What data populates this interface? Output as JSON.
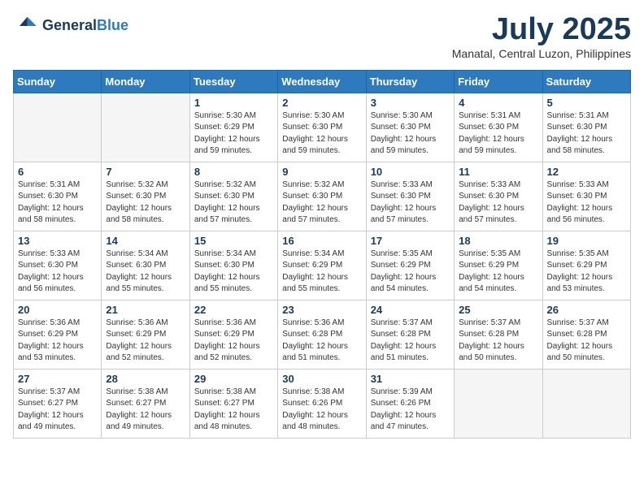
{
  "header": {
    "logo_line1": "General",
    "logo_line2": "Blue",
    "month": "July 2025",
    "location": "Manatal, Central Luzon, Philippines"
  },
  "days_of_week": [
    "Sunday",
    "Monday",
    "Tuesday",
    "Wednesday",
    "Thursday",
    "Friday",
    "Saturday"
  ],
  "weeks": [
    [
      {
        "day": "",
        "empty": true
      },
      {
        "day": "",
        "empty": true
      },
      {
        "day": "1",
        "sunrise": "Sunrise: 5:30 AM",
        "sunset": "Sunset: 6:29 PM",
        "daylight": "Daylight: 12 hours and 59 minutes."
      },
      {
        "day": "2",
        "sunrise": "Sunrise: 5:30 AM",
        "sunset": "Sunset: 6:30 PM",
        "daylight": "Daylight: 12 hours and 59 minutes."
      },
      {
        "day": "3",
        "sunrise": "Sunrise: 5:30 AM",
        "sunset": "Sunset: 6:30 PM",
        "daylight": "Daylight: 12 hours and 59 minutes."
      },
      {
        "day": "4",
        "sunrise": "Sunrise: 5:31 AM",
        "sunset": "Sunset: 6:30 PM",
        "daylight": "Daylight: 12 hours and 59 minutes."
      },
      {
        "day": "5",
        "sunrise": "Sunrise: 5:31 AM",
        "sunset": "Sunset: 6:30 PM",
        "daylight": "Daylight: 12 hours and 58 minutes."
      }
    ],
    [
      {
        "day": "6",
        "sunrise": "Sunrise: 5:31 AM",
        "sunset": "Sunset: 6:30 PM",
        "daylight": "Daylight: 12 hours and 58 minutes."
      },
      {
        "day": "7",
        "sunrise": "Sunrise: 5:32 AM",
        "sunset": "Sunset: 6:30 PM",
        "daylight": "Daylight: 12 hours and 58 minutes."
      },
      {
        "day": "8",
        "sunrise": "Sunrise: 5:32 AM",
        "sunset": "Sunset: 6:30 PM",
        "daylight": "Daylight: 12 hours and 57 minutes."
      },
      {
        "day": "9",
        "sunrise": "Sunrise: 5:32 AM",
        "sunset": "Sunset: 6:30 PM",
        "daylight": "Daylight: 12 hours and 57 minutes."
      },
      {
        "day": "10",
        "sunrise": "Sunrise: 5:33 AM",
        "sunset": "Sunset: 6:30 PM",
        "daylight": "Daylight: 12 hours and 57 minutes."
      },
      {
        "day": "11",
        "sunrise": "Sunrise: 5:33 AM",
        "sunset": "Sunset: 6:30 PM",
        "daylight": "Daylight: 12 hours and 57 minutes."
      },
      {
        "day": "12",
        "sunrise": "Sunrise: 5:33 AM",
        "sunset": "Sunset: 6:30 PM",
        "daylight": "Daylight: 12 hours and 56 minutes."
      }
    ],
    [
      {
        "day": "13",
        "sunrise": "Sunrise: 5:33 AM",
        "sunset": "Sunset: 6:30 PM",
        "daylight": "Daylight: 12 hours and 56 minutes."
      },
      {
        "day": "14",
        "sunrise": "Sunrise: 5:34 AM",
        "sunset": "Sunset: 6:30 PM",
        "daylight": "Daylight: 12 hours and 55 minutes."
      },
      {
        "day": "15",
        "sunrise": "Sunrise: 5:34 AM",
        "sunset": "Sunset: 6:30 PM",
        "daylight": "Daylight: 12 hours and 55 minutes."
      },
      {
        "day": "16",
        "sunrise": "Sunrise: 5:34 AM",
        "sunset": "Sunset: 6:29 PM",
        "daylight": "Daylight: 12 hours and 55 minutes."
      },
      {
        "day": "17",
        "sunrise": "Sunrise: 5:35 AM",
        "sunset": "Sunset: 6:29 PM",
        "daylight": "Daylight: 12 hours and 54 minutes."
      },
      {
        "day": "18",
        "sunrise": "Sunrise: 5:35 AM",
        "sunset": "Sunset: 6:29 PM",
        "daylight": "Daylight: 12 hours and 54 minutes."
      },
      {
        "day": "19",
        "sunrise": "Sunrise: 5:35 AM",
        "sunset": "Sunset: 6:29 PM",
        "daylight": "Daylight: 12 hours and 53 minutes."
      }
    ],
    [
      {
        "day": "20",
        "sunrise": "Sunrise: 5:36 AM",
        "sunset": "Sunset: 6:29 PM",
        "daylight": "Daylight: 12 hours and 53 minutes."
      },
      {
        "day": "21",
        "sunrise": "Sunrise: 5:36 AM",
        "sunset": "Sunset: 6:29 PM",
        "daylight": "Daylight: 12 hours and 52 minutes."
      },
      {
        "day": "22",
        "sunrise": "Sunrise: 5:36 AM",
        "sunset": "Sunset: 6:29 PM",
        "daylight": "Daylight: 12 hours and 52 minutes."
      },
      {
        "day": "23",
        "sunrise": "Sunrise: 5:36 AM",
        "sunset": "Sunset: 6:28 PM",
        "daylight": "Daylight: 12 hours and 51 minutes."
      },
      {
        "day": "24",
        "sunrise": "Sunrise: 5:37 AM",
        "sunset": "Sunset: 6:28 PM",
        "daylight": "Daylight: 12 hours and 51 minutes."
      },
      {
        "day": "25",
        "sunrise": "Sunrise: 5:37 AM",
        "sunset": "Sunset: 6:28 PM",
        "daylight": "Daylight: 12 hours and 50 minutes."
      },
      {
        "day": "26",
        "sunrise": "Sunrise: 5:37 AM",
        "sunset": "Sunset: 6:28 PM",
        "daylight": "Daylight: 12 hours and 50 minutes."
      }
    ],
    [
      {
        "day": "27",
        "sunrise": "Sunrise: 5:37 AM",
        "sunset": "Sunset: 6:27 PM",
        "daylight": "Daylight: 12 hours and 49 minutes."
      },
      {
        "day": "28",
        "sunrise": "Sunrise: 5:38 AM",
        "sunset": "Sunset: 6:27 PM",
        "daylight": "Daylight: 12 hours and 49 minutes."
      },
      {
        "day": "29",
        "sunrise": "Sunrise: 5:38 AM",
        "sunset": "Sunset: 6:27 PM",
        "daylight": "Daylight: 12 hours and 48 minutes."
      },
      {
        "day": "30",
        "sunrise": "Sunrise: 5:38 AM",
        "sunset": "Sunset: 6:26 PM",
        "daylight": "Daylight: 12 hours and 48 minutes."
      },
      {
        "day": "31",
        "sunrise": "Sunrise: 5:39 AM",
        "sunset": "Sunset: 6:26 PM",
        "daylight": "Daylight: 12 hours and 47 minutes."
      },
      {
        "day": "",
        "empty": true
      },
      {
        "day": "",
        "empty": true
      }
    ]
  ]
}
